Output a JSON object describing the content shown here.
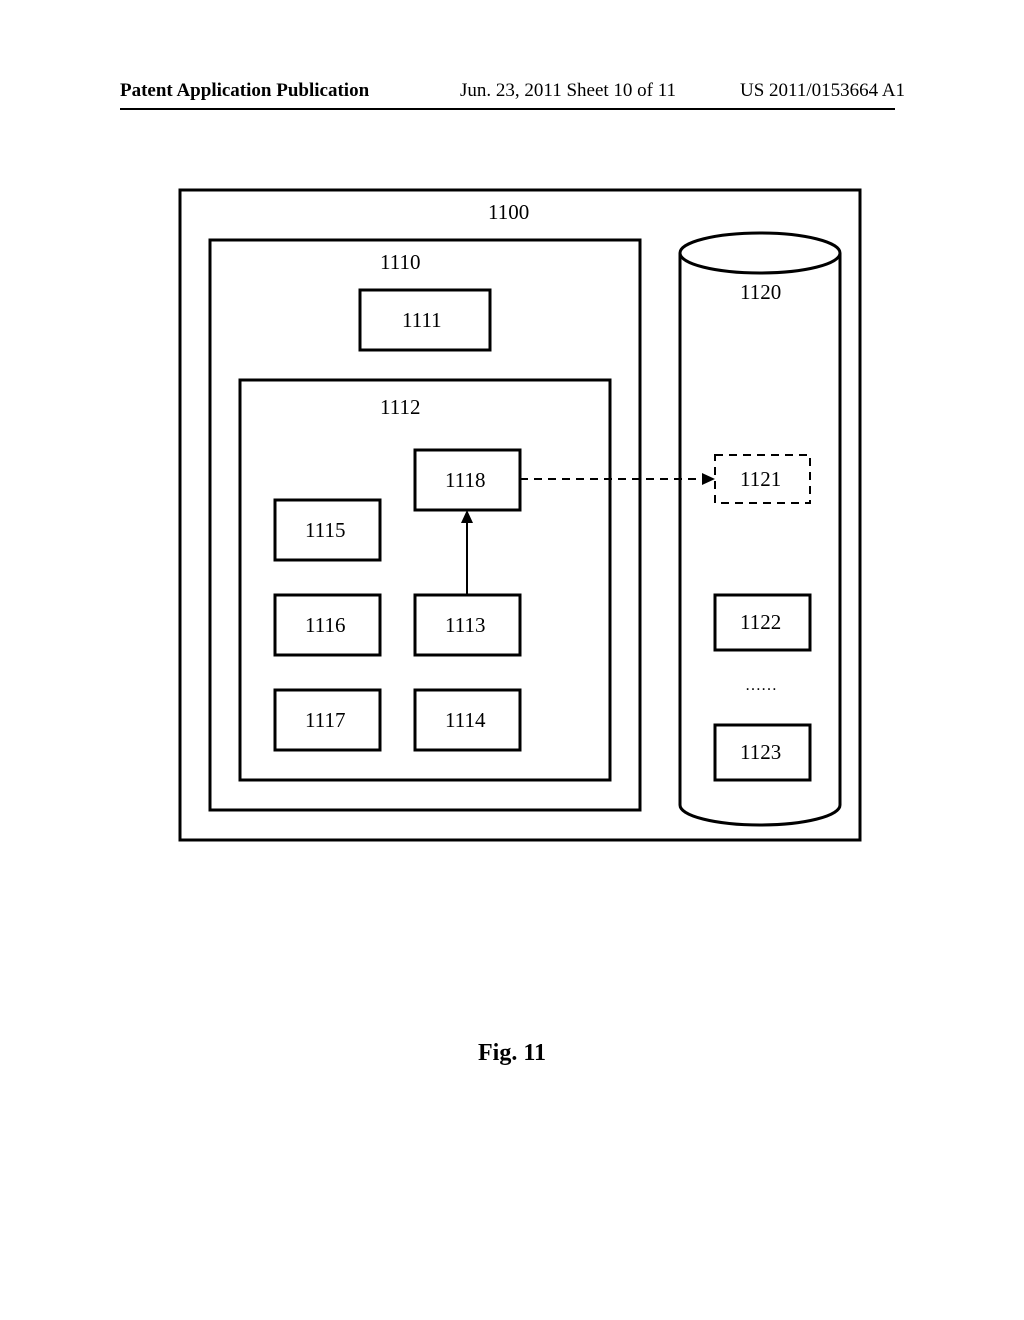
{
  "header": {
    "left": "Patent Application Publication",
    "mid": "Jun. 23, 2011  Sheet 10 of 11",
    "right": "US 2011/0153664 A1"
  },
  "labels": {
    "n1100": "1100",
    "n1110": "1110",
    "n1111": "1111",
    "n1112": "1112",
    "n1113": "1113",
    "n1114": "1114",
    "n1115": "1115",
    "n1116": "1116",
    "n1117": "1117",
    "n1118": "1118",
    "n1120": "1120",
    "n1121": "1121",
    "n1122": "1122",
    "n1123": "1123",
    "dots": "……"
  },
  "figure": "Fig. 11"
}
